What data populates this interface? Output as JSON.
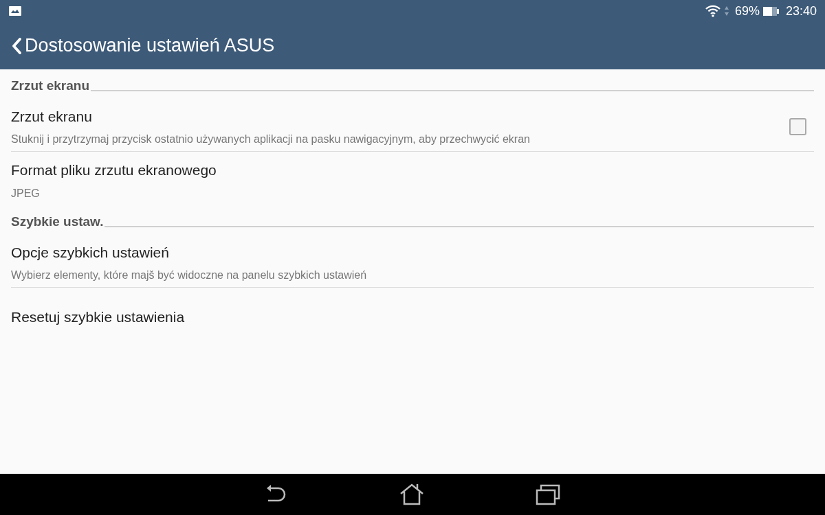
{
  "status_bar": {
    "battery": "69%",
    "time": "23:40"
  },
  "app_bar": {
    "title": "Dostosowanie ustawień ASUS"
  },
  "sections": [
    {
      "title": "Zrzut ekranu",
      "items": [
        {
          "kind": "checkbox",
          "title": "Zrzut ekranu",
          "summary": "Stuknij i przytrzymaj przycisk ostatnio używanych aplikacji na pasku nawigacyjnym, aby przechwycić ekran",
          "checked": false
        },
        {
          "kind": "plain",
          "title": "Format pliku zrzutu ekranowego",
          "summary": "JPEG"
        }
      ]
    },
    {
      "title": "Szybkie ustaw.",
      "items": [
        {
          "kind": "plain",
          "title": "Opcje szybkich ustawień",
          "summary": "Wybierz elementy, które majš być widoczne na panelu szybkich ustawień"
        },
        {
          "kind": "plain",
          "title": "Resetuj szybkie ustawienia"
        }
      ]
    }
  ]
}
